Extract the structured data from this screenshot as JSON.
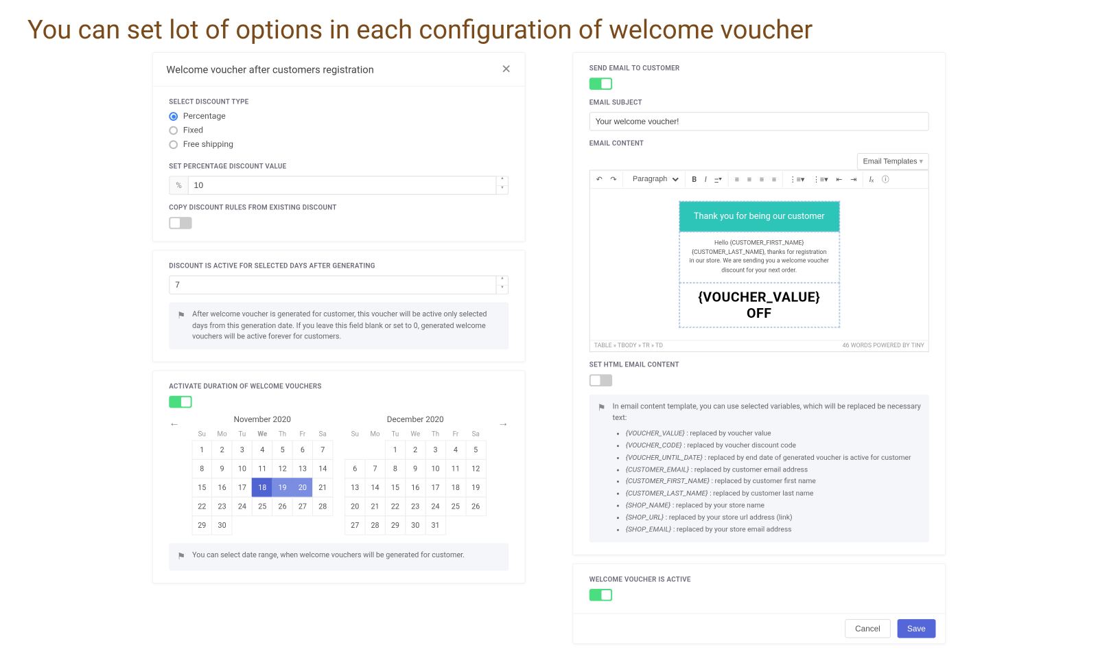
{
  "page_title": "You can set lot of options in each configuration of welcome voucher",
  "left": {
    "header": "Welcome voucher after customers registration",
    "discount_type": {
      "label": "SELECT DISCOUNT TYPE",
      "options": [
        "Percentage",
        "Fixed",
        "Free shipping"
      ],
      "selected": 0
    },
    "pct": {
      "label": "SET PERCENTAGE DISCOUNT VALUE",
      "prefix": "%",
      "value": "10"
    },
    "copy": {
      "label": "COPY DISCOUNT RULES FROM EXISTING DISCOUNT",
      "on": false
    },
    "active_days": {
      "label": "DISCOUNT IS ACTIVE FOR SELECTED DAYS AFTER GENERATING",
      "value": "7",
      "note": "After welcome voucher is generated for customer, this voucher will be active only selected days from this generation date. If you leave this field blank or set to 0, generated welcome vouchers will be active forever for customers."
    },
    "duration": {
      "label": "ACTIVATE DURATION OF WELCOME VOUCHERS",
      "on": true,
      "months": [
        {
          "title": "November 2020",
          "dow": [
            "Su",
            "Mo",
            "Tu",
            "We",
            "Th",
            "Fr",
            "Sa"
          ],
          "bold_dow_index": 3,
          "lead": 0,
          "days": 30,
          "sel_start": 18,
          "sel_end": 20
        },
        {
          "title": "December 2020",
          "dow": [
            "Su",
            "Mo",
            "Tu",
            "We",
            "Th",
            "Fr",
            "Sa"
          ],
          "bold_dow_index": -1,
          "lead": 2,
          "days": 31,
          "sel_start": 0,
          "sel_end": 0
        }
      ],
      "note": "You can select date range, when welcome vouchers will be generated for customer."
    }
  },
  "right": {
    "send": {
      "label": "SEND EMAIL TO CUSTOMER",
      "on": true
    },
    "subject": {
      "label": "EMAIL SUBJECT",
      "value": "Your welcome voucher!"
    },
    "content_label": "EMAIL CONTENT",
    "templates_btn": "Email Templates",
    "toolbar": {
      "para": "Paragraph"
    },
    "preview": {
      "header": "Thank you for being our customer",
      "body": "Hello {CUSTOMER_FIRST_NAME} {CUSTOMER_LAST_NAME}, thanks for registration in our store. We are sending you a welcome voucher discount for your next order.",
      "big1": "{VOUCHER_VALUE}",
      "big2": "OFF"
    },
    "status_path": "TABLE » TBODY » TR » TD",
    "status_right": "46 WORDS  POWERED BY TINY",
    "html_toggle": {
      "label": "SET HTML EMAIL CONTENT",
      "on": false
    },
    "vars_intro": "In email content template, you can use selected variables, which will be replaced be necessary text:",
    "vars": [
      "{VOUCHER_VALUE} : replaced by voucher value",
      "{VOUCHER_CODE} : replaced by voucher discount code",
      "{VOUCHER_UNTIL_DATE} : replaced by end date of generated voucher is active for customer",
      "{CUSTOMER_EMAIL} : replaced by customer email address",
      "{CUSTOMER_FIRST_NAME} : replaced by customer first name",
      "{CUSTOMER_LAST_NAME} : replaced by customer last name",
      "{SHOP_NAME} : replaced by your store name",
      "{SHOP_URL} : replaced by your store url address (link)",
      "{SHOP_EMAIL} : replaced by your store email address"
    ],
    "active": {
      "label": "WELCOME VOUCHER IS ACTIVE",
      "on": true
    },
    "cancel": "Cancel",
    "save": "Save"
  }
}
